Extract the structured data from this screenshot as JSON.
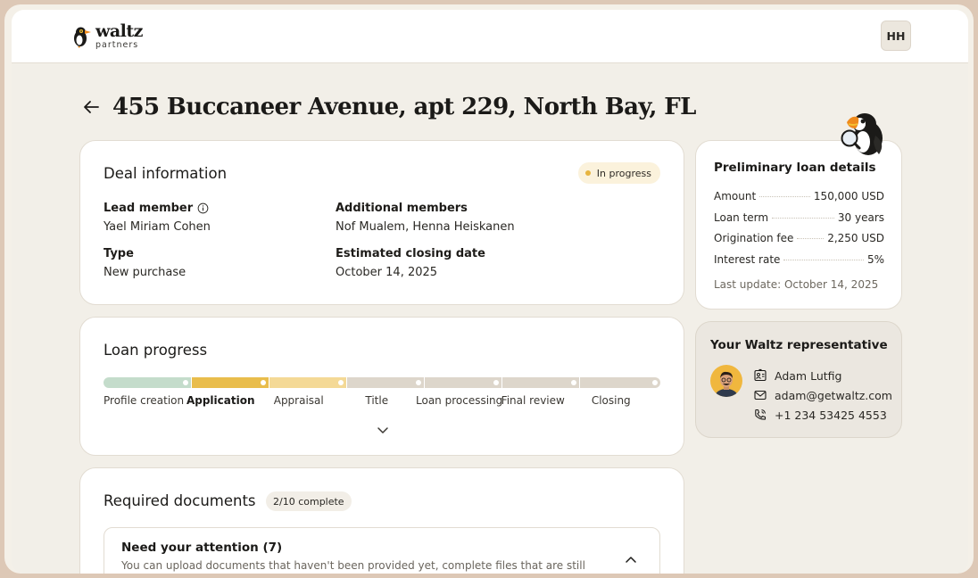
{
  "brand": {
    "name": "waltz",
    "sub": "partners"
  },
  "user": {
    "initials": "HH"
  },
  "page": {
    "title": "455 Buccaneer Avenue, apt 229, North Bay, FL"
  },
  "deal": {
    "title": "Deal information",
    "status": "In progress",
    "lead_member_label": "Lead member",
    "lead_member": "Yael Miriam Cohen",
    "additional_members_label": "Additional members",
    "additional_members": "Nof Mualem, Henna Heiskanen",
    "type_label": "Type",
    "type": "New purchase",
    "closing_label": "Estimated closing date",
    "closing": "October 14, 2025"
  },
  "progress": {
    "title": "Loan progress",
    "steps": [
      "Profile creation",
      "Application",
      "Appraisal",
      "Title",
      "Loan processing",
      "Final review",
      "Closing"
    ],
    "current_step": "Application"
  },
  "documents": {
    "title": "Required documents",
    "count": "2/10 complete",
    "attention_title": "Need your attention (7)",
    "attention_sub": "You can upload documents that haven't been provided yet, complete files that are still"
  },
  "loan": {
    "title": "Preliminary loan details",
    "rows": [
      {
        "label": "Amount",
        "value": "150,000 USD"
      },
      {
        "label": "Loan term",
        "value": "30 years"
      },
      {
        "label": "Origination fee",
        "value": "2,250 USD"
      },
      {
        "label": "Interest rate",
        "value": "5%"
      }
    ],
    "last_update": "Last update: October 14, 2025"
  },
  "rep": {
    "title": "Your Waltz representative",
    "name": "Adam Lutfig",
    "email": "adam@getwaltz.com",
    "phone": "+1 234 53425 4553"
  },
  "colors": {
    "accent": "#e9bd4c",
    "done": "#c4dccb",
    "todo": "#ddd6cb",
    "status_dot": "#e7b43f"
  }
}
